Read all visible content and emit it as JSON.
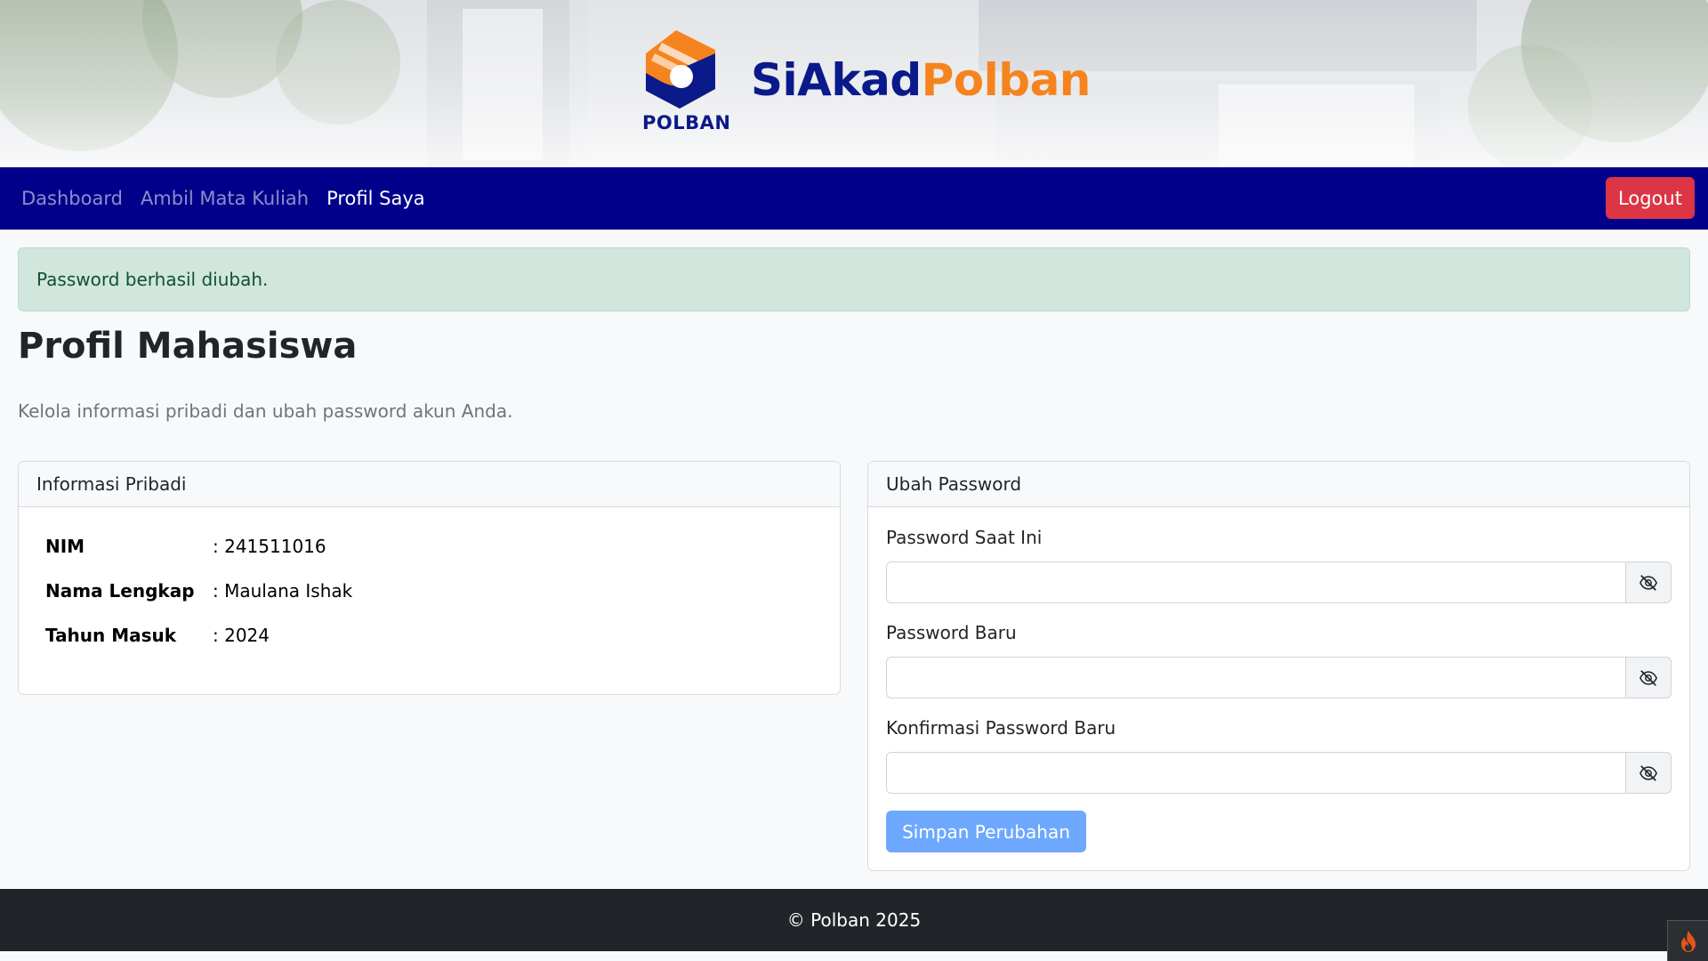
{
  "header": {
    "logo_text": "POLBAN",
    "title_part1": "SiAkad",
    "title_part2": "Polban",
    "brand_colors": {
      "navy": "#0b1a8a",
      "orange": "#f5841f"
    }
  },
  "navbar": {
    "items": [
      {
        "label": "Dashboard",
        "active": false
      },
      {
        "label": "Ambil Mata Kuliah",
        "active": false
      },
      {
        "label": "Profil Saya",
        "active": true
      }
    ],
    "logout_label": "Logout",
    "bg_color": "#00008b"
  },
  "alert": {
    "message": "Password berhasil diubah.",
    "type": "success"
  },
  "page": {
    "title": "Profil Mahasiswa",
    "subtitle": "Kelola informasi pribadi dan ubah password akun Anda."
  },
  "personal_info": {
    "header": "Informasi Pribadi",
    "rows": [
      {
        "label": "NIM",
        "value": ": 241511016"
      },
      {
        "label": "Nama Lengkap",
        "value": ": Maulana Ishak"
      },
      {
        "label": "Tahun Masuk",
        "value": ": 2024"
      }
    ]
  },
  "change_password": {
    "header": "Ubah Password",
    "fields": [
      {
        "label": "Password Saat Ini",
        "value": "",
        "toggle_icon": "eye-slash-icon"
      },
      {
        "label": "Password Baru",
        "value": "",
        "toggle_icon": "eye-slash-icon"
      },
      {
        "label": "Konfirmasi Password Baru",
        "value": "",
        "toggle_icon": "eye-slash-icon"
      }
    ],
    "submit_label": "Simpan Perubahan"
  },
  "footer": {
    "text": "© Polban 2025"
  }
}
